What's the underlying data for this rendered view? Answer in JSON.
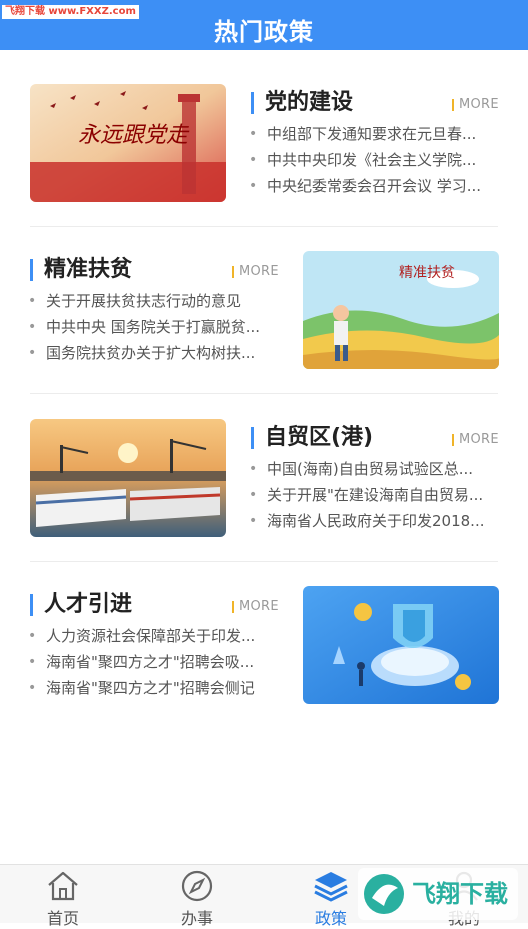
{
  "header": {
    "title": "热门政策",
    "watermark": "飞翔下载 www.FXXZ.com"
  },
  "more_label": "MORE",
  "sections": [
    {
      "title": "党的建设",
      "image_text": "永远跟党走",
      "items": [
        "中组部下发通知要求在元旦春...",
        "中共中央印发《社会主义学院...",
        "中央纪委常委会召开会议 学习..."
      ]
    },
    {
      "title": "精准扶贫",
      "image_text": "精准扶贫",
      "items": [
        "关于开展扶贫扶志行动的意见",
        "中共中央 国务院关于打赢脱贫...",
        "国务院扶贫办关于扩大构树扶..."
      ]
    },
    {
      "title": "自贸区(港)",
      "items": [
        "中国(海南)自由贸易试验区总...",
        "关于开展\"在建设海南自由贸易...",
        "海南省人民政府关于印发2018..."
      ]
    },
    {
      "title": "人才引进",
      "items": [
        "人力资源社会保障部关于印发...",
        "海南省\"聚四方之才\"招聘会吸...",
        "海南省\"聚四方之才\"招聘会侧记"
      ]
    }
  ],
  "tabs": [
    {
      "label": "首页",
      "icon": "home-icon"
    },
    {
      "label": "办事",
      "icon": "compass-icon"
    },
    {
      "label": "政策",
      "icon": "layers-icon"
    },
    {
      "label": "我的",
      "icon": "user-icon"
    }
  ],
  "active_tab": "政策",
  "corner_watermark": "飞翔下载",
  "colors": {
    "accent": "#3d8ff5",
    "more_bar": "#f0b429",
    "active_tab": "#2a7de1"
  }
}
